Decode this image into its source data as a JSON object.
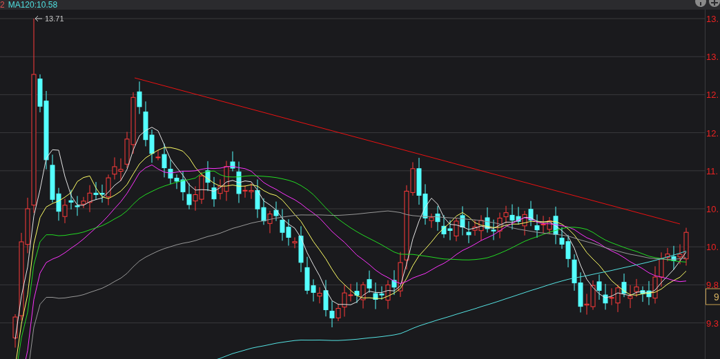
{
  "header": {
    "period_fragment": "2",
    "ma_label": "MA120:10.58"
  },
  "chart": {
    "high_marker": "13.71",
    "price_axis": [
      "13.",
      "13.",
      "12.",
      "12.",
      "11.",
      "10.",
      "10.",
      "9.8",
      "9.3"
    ],
    "current_price_box": "9"
  }
}
